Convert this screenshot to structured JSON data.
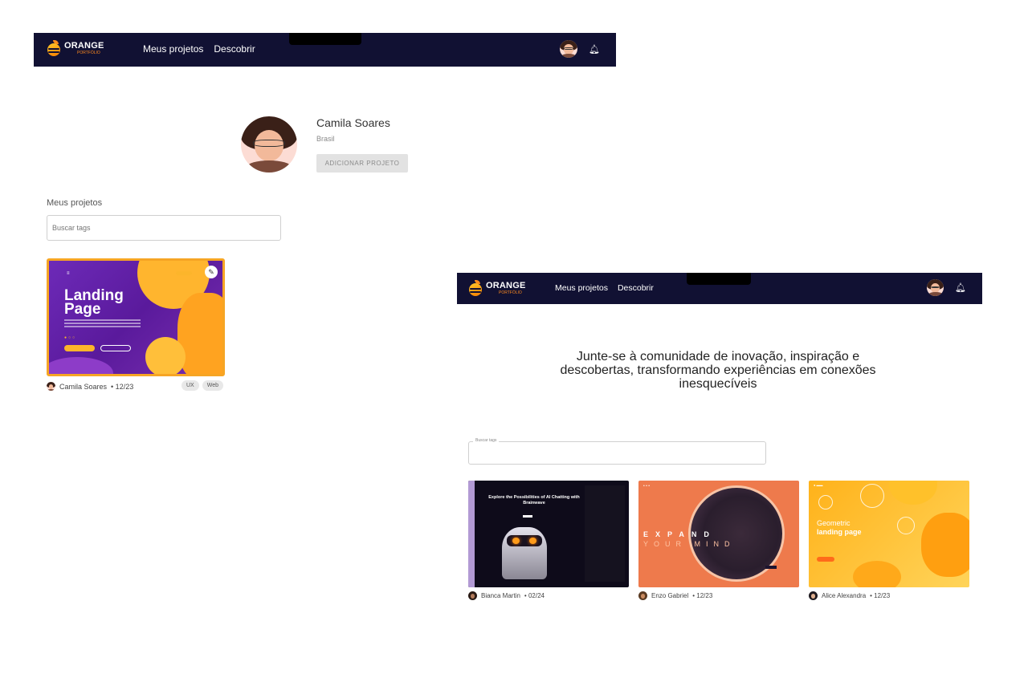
{
  "profile_screen": {
    "logo": {
      "title": "ORANGE",
      "subtitle": "PORTFÓLIO"
    },
    "nav": [
      "Meus projetos",
      "Descobrir"
    ],
    "profile": {
      "name": "Camila Soares",
      "country": "Brasil",
      "add_button": "ADICIONAR PROJETO"
    },
    "section_title": "Meus projetos",
    "search_placeholder": "Buscar tags",
    "project": {
      "thumb_title_line1": "Landing",
      "thumb_title_line2": "Page",
      "author": "Camila Soares",
      "date": "• 12/23",
      "tags": [
        "UX",
        "Web"
      ]
    }
  },
  "discover_screen": {
    "logo": {
      "title": "ORANGE",
      "subtitle": "PORTFÓLIO"
    },
    "nav": [
      "Meus projetos",
      "Descobrir"
    ],
    "headline": "Junte-se à comunidade de inovação, inspiração e descobertas, transformando experiências em conexões inesquecíveis",
    "search_label": "Buscar tags",
    "cards": [
      {
        "author": "Bianca Martin",
        "date": "• 02/24",
        "thumb_text": "Explore the Possibilities of AI Chatting with Brainwave"
      },
      {
        "author": "Enzo Gabriel",
        "date": "• 12/23",
        "thumb_text_1": "EXPAND",
        "thumb_text_2": "YOUR MIND"
      },
      {
        "author": "Alice Alexandra",
        "date": "• 12/23",
        "thumb_text_1": "Geometric",
        "thumb_text_2": "landing page"
      }
    ]
  },
  "colors": {
    "topbar": "#111133",
    "accent": "#ff8a1e",
    "button_disabled": "#e2e2e2"
  },
  "icons": [
    "bell-icon",
    "edit-icon",
    "orange-logo-icon"
  ]
}
